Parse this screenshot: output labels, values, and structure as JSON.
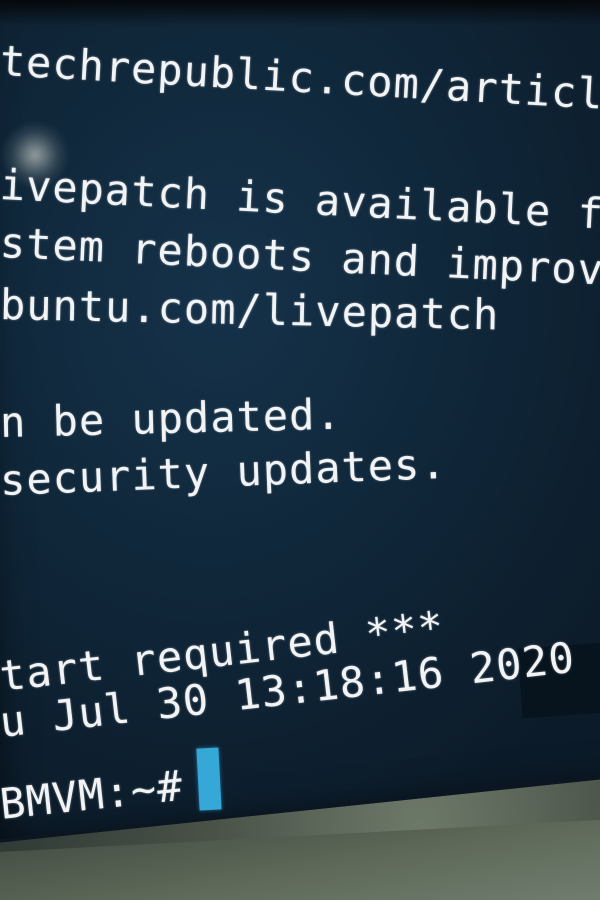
{
  "terminal": {
    "lines": [
      "techrepublic.com/article/ho",
      "ivepatch is available for in",
      "stem reboots and improve ke",
      "buntu.com/livepatch",
      "n be updated.",
      "security updates.",
      "tart required ***",
      "u Jul 30 13:18:16 2020",
      "BMVM:~#"
    ]
  },
  "colors": {
    "screen_bg": "#0f2537",
    "text": "#f1f3f5",
    "cursor": "#36a8d8"
  }
}
